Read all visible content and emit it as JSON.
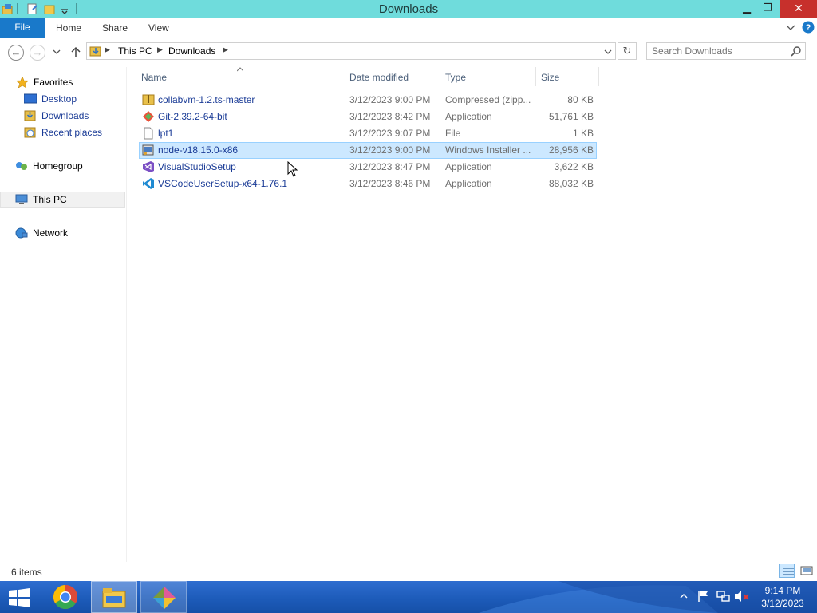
{
  "window": {
    "title": "Downloads"
  },
  "ribbon": {
    "file": "File",
    "tabs": [
      "Home",
      "Share",
      "View"
    ]
  },
  "address": {
    "crumbs": [
      "This PC",
      "Downloads"
    ]
  },
  "search": {
    "placeholder": "Search Downloads"
  },
  "nav": {
    "favorites": "Favorites",
    "favorite_items": [
      "Desktop",
      "Downloads",
      "Recent places"
    ],
    "homegroup": "Homegroup",
    "thispc": "This PC",
    "network": "Network"
  },
  "columns": {
    "name": "Name",
    "date": "Date modified",
    "type": "Type",
    "size": "Size"
  },
  "files": [
    {
      "name": "collabvm-1.2.ts-master",
      "date": "3/12/2023 9:00 PM",
      "type": "Compressed (zipp...",
      "size": "80 KB",
      "icon": "zip-folder-icon"
    },
    {
      "name": "Git-2.39.2-64-bit",
      "date": "3/12/2023 8:42 PM",
      "type": "Application",
      "size": "51,761 KB",
      "icon": "git-icon"
    },
    {
      "name": "lpt1",
      "date": "3/12/2023 9:07 PM",
      "type": "File",
      "size": "1 KB",
      "icon": "file-icon"
    },
    {
      "name": "node-v18.15.0-x86",
      "date": "3/12/2023 9:00 PM",
      "type": "Windows Installer ...",
      "size": "28,956 KB",
      "icon": "msi-icon",
      "selected": true
    },
    {
      "name": "VisualStudioSetup",
      "date": "3/12/2023 8:47 PM",
      "type": "Application",
      "size": "3,622 KB",
      "icon": "visual-studio-icon"
    },
    {
      "name": "VSCodeUserSetup-x64-1.76.1",
      "date": "3/12/2023 8:46 PM",
      "type": "Application",
      "size": "88,032 KB",
      "icon": "vscode-icon"
    }
  ],
  "status": {
    "items": "6 items"
  },
  "taskbar": {
    "time": "9:14 PM",
    "date": "3/12/2023"
  },
  "colors": {
    "titlebar": "#6fdcdc",
    "accent": "#1979ca",
    "selection": "#cce8ff",
    "taskbar": "#1c5ab8",
    "close": "#c7302c"
  }
}
